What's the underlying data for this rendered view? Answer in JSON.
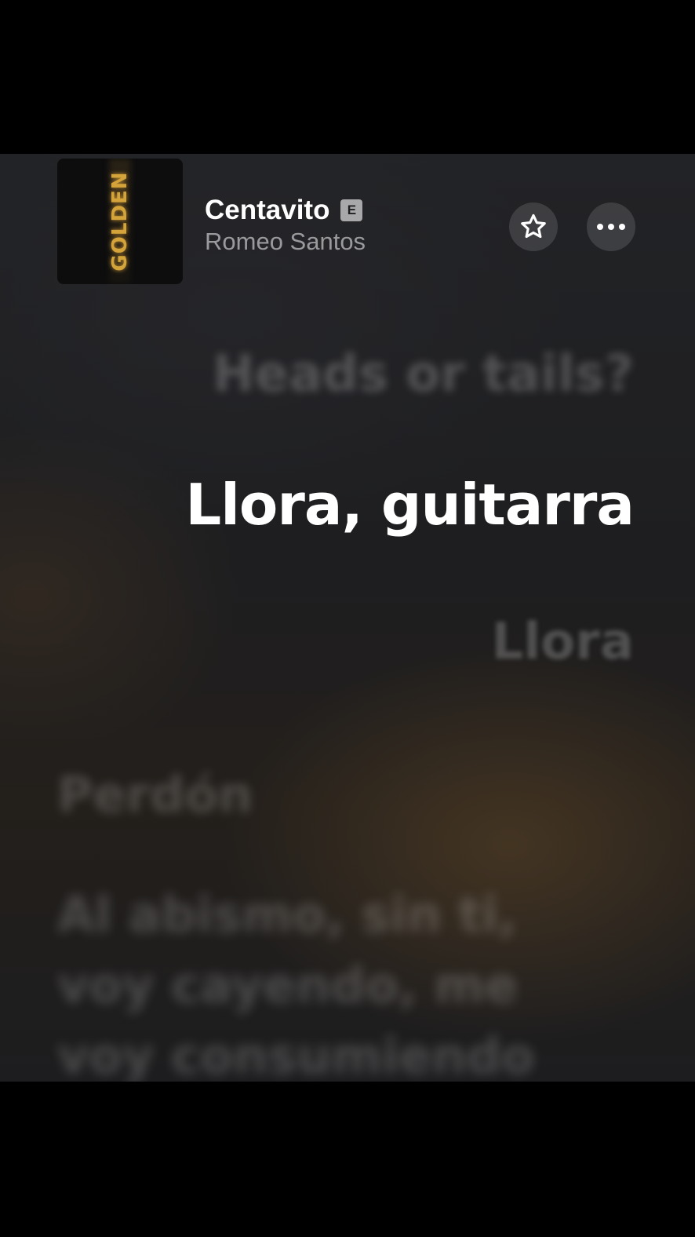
{
  "track": {
    "title": "Centavito",
    "explicit_label": "E",
    "artist": "Romeo Santos",
    "album_art_text": "GOLDEN"
  },
  "actions": {
    "favorite_icon": "star-icon",
    "more_icon": "ellipsis-icon"
  },
  "lyrics": {
    "previous": "Heads or tails?",
    "current": "Llora, guitarra",
    "next": "Llora",
    "later": "Perdón",
    "upcoming_block": "Al abismo, sin ti, voy cayendo, me voy consumiendo"
  },
  "colors": {
    "accent_gold": "#d4a43a",
    "background": "#1e1e20",
    "current_lyric": "#ffffff"
  }
}
